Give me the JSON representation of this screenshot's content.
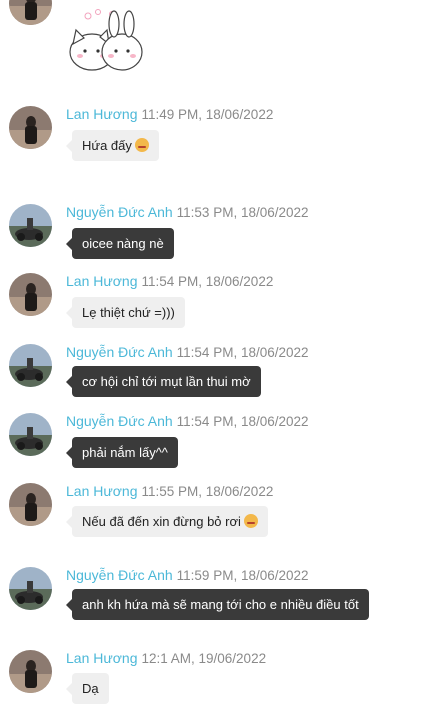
{
  "messages": [
    {
      "sender": "Lan Hương",
      "time": "11:49 PM, 18/06/2022",
      "text": "Hứa đấy",
      "emoji": "pouting-face-emoji"
    },
    {
      "sender": "Nguyễn Đức Anh",
      "time": "11:53 PM, 18/06/2022",
      "text": "oicee nàng nè"
    },
    {
      "sender": "Lan Hương",
      "time": "11:54 PM, 18/06/2022",
      "text": "Lẹ thiệt chứ =)))"
    },
    {
      "sender": "Nguyễn Đức Anh",
      "time": "11:54 PM, 18/06/2022",
      "text": "cơ hội chỉ tới mụt lần thui mờ"
    },
    {
      "sender": "Nguyễn Đức Anh",
      "time": "11:54 PM, 18/06/2022",
      "text": "phải nắm lấy^^"
    },
    {
      "sender": "Lan Hương",
      "time": "11:55 PM, 18/06/2022",
      "text": "Nếu đã đến xin đừng bỏ rơi",
      "emoji": "pleading-face-emoji"
    },
    {
      "sender": "Nguyễn Đức Anh",
      "time": "11:59 PM, 18/06/2022",
      "text": "anh kh hứa mà sẽ mang tới cho e nhiều điều tốt"
    },
    {
      "sender": "Lan Hương",
      "time": "12:1 AM, 19/06/2022",
      "text": "Dạ"
    }
  ],
  "sticker": {
    "icon": "cat-and-bunny-sticker"
  }
}
